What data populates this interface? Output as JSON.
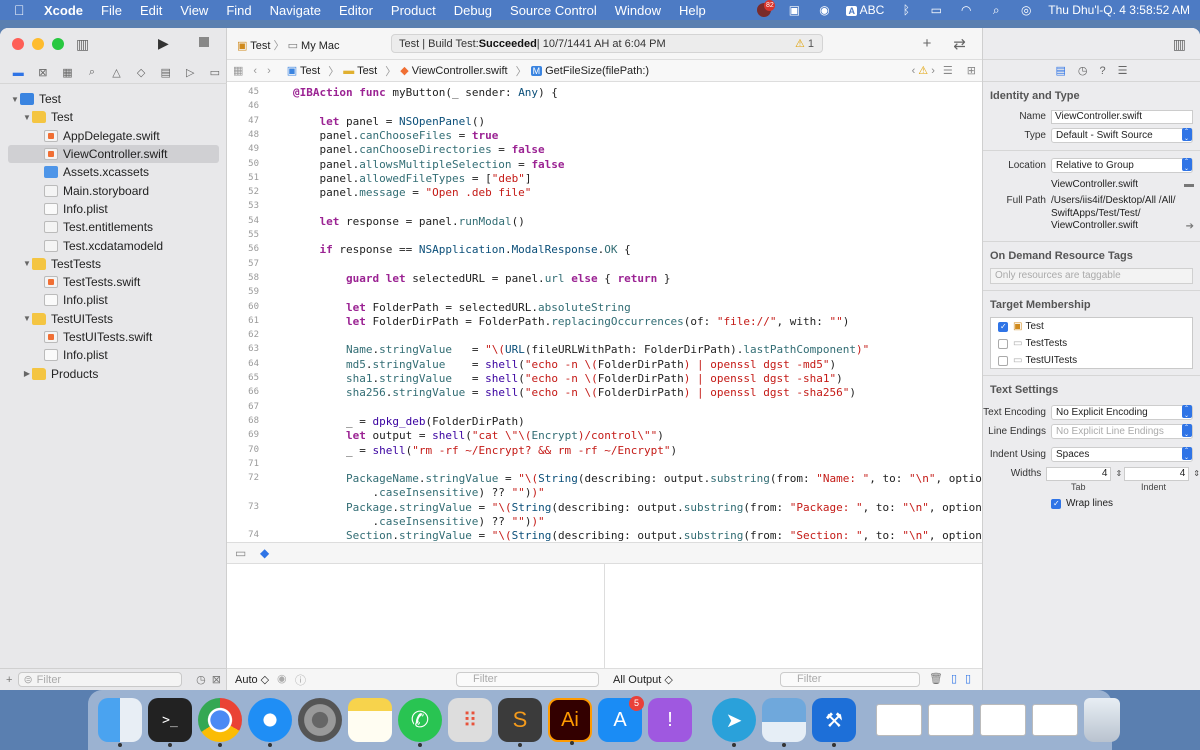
{
  "menubar": {
    "app": "Xcode",
    "items": [
      "File",
      "Edit",
      "View",
      "Find",
      "Navigate",
      "Editor",
      "Product",
      "Debug",
      "Source Control",
      "Window",
      "Help"
    ],
    "status_badge": "82",
    "input_label": "ABC",
    "clock": "Thu Dhu'l-Q. 4  3:58:52 AM"
  },
  "toolbar": {
    "scheme_target": "Test",
    "scheme_device": "My Mac",
    "status_prefix": "Test | Build Test: ",
    "status_bold": "Succeeded",
    "status_suffix": " | 10/7/1441 AH at 6:04 PM",
    "warning_count": "1"
  },
  "jumpbar": {
    "items": [
      "Test",
      "Test",
      "ViewController.swift",
      "GetFileSize(filePath:)"
    ]
  },
  "navigator": {
    "items": [
      {
        "label": "Test",
        "level": 0,
        "icon": "project",
        "disclosure": "open"
      },
      {
        "label": "Test",
        "level": 1,
        "icon": "folder",
        "disclosure": "open"
      },
      {
        "label": "AppDelegate.swift",
        "level": 2,
        "icon": "swift"
      },
      {
        "label": "ViewController.swift",
        "level": 2,
        "icon": "swift",
        "selected": true
      },
      {
        "label": "Assets.xcassets",
        "level": 2,
        "icon": "asset"
      },
      {
        "label": "Main.storyboard",
        "level": 2,
        "icon": "storyboard"
      },
      {
        "label": "Info.plist",
        "level": 2,
        "icon": "plist"
      },
      {
        "label": "Test.entitlements",
        "level": 2,
        "icon": "entitlements"
      },
      {
        "label": "Test.xcdatamodeld",
        "level": 2,
        "icon": "datamodel"
      },
      {
        "label": "TestTests",
        "level": 1,
        "icon": "folder",
        "disclosure": "open"
      },
      {
        "label": "TestTests.swift",
        "level": 2,
        "icon": "swift"
      },
      {
        "label": "Info.plist",
        "level": 2,
        "icon": "plist"
      },
      {
        "label": "TestUITests",
        "level": 1,
        "icon": "folder",
        "disclosure": "open"
      },
      {
        "label": "TestUITests.swift",
        "level": 2,
        "icon": "swift"
      },
      {
        "label": "Info.plist",
        "level": 2,
        "icon": "plist"
      },
      {
        "label": "Products",
        "level": 1,
        "icon": "folder",
        "disclosure": "closed"
      }
    ],
    "filter_placeholder": "Filter"
  },
  "code": [
    {
      "n": "45",
      "h": "<span class='k'>@IBAction</span> <span class='k'>func</span> myButton(_ sender: <span class='t'>Any</span>) {"
    },
    {
      "n": "46",
      "h": ""
    },
    {
      "n": "47",
      "h": "    <span class='k'>let</span> panel = <span class='t'>NSOpenPanel</span>()"
    },
    {
      "n": "48",
      "h": "    panel.<span class='p'>canChooseFiles</span> = <span class='k'>true</span>"
    },
    {
      "n": "49",
      "h": "    panel.<span class='p'>canChooseDirectories</span> = <span class='k'>false</span>"
    },
    {
      "n": "50",
      "h": "    panel.<span class='p'>allowsMultipleSelection</span> = <span class='k'>false</span>"
    },
    {
      "n": "51",
      "h": "    panel.<span class='p'>allowedFileTypes</span> = [<span class='s'>\"deb\"</span>]"
    },
    {
      "n": "52",
      "h": "    panel.<span class='p'>message</span> = <span class='s'>\"Open .deb file\"</span>"
    },
    {
      "n": "53",
      "h": ""
    },
    {
      "n": "54",
      "h": "    <span class='k'>let</span> response = panel.<span class='p'>runModal</span>()"
    },
    {
      "n": "55",
      "h": ""
    },
    {
      "n": "56",
      "h": "    <span class='k'>if</span> response == <span class='t'>NSApplication</span>.<span class='t'>ModalResponse</span>.<span class='p'>OK</span> {"
    },
    {
      "n": "57",
      "h": ""
    },
    {
      "n": "58",
      "h": "        <span class='k'>guard</span> <span class='k'>let</span> selectedURL = panel.<span class='p'>url</span> <span class='k'>else</span> { <span class='k'>return</span> }"
    },
    {
      "n": "59",
      "h": ""
    },
    {
      "n": "60",
      "h": "        <span class='k'>let</span> FolderPath = selectedURL.<span class='p'>absoluteString</span>"
    },
    {
      "n": "61",
      "h": "        <span class='k'>let</span> FolderDirPath = FolderPath.<span class='p'>replacingOccurrences</span>(of: <span class='s'>\"file://\"</span>, with: <span class='s'>\"\"</span>)"
    },
    {
      "n": "62",
      "h": ""
    },
    {
      "n": "63",
      "h": "        <span class='p'>Name</span>.<span class='p'>stringValue</span>   = <span class='s'>\"\\(</span><span class='t'>URL</span>(fileURLWithPath: FolderDirPath).<span class='p'>lastPathComponent</span><span class='s'>)\"</span>"
    },
    {
      "n": "64",
      "h": "        <span class='p'>md5</span>.<span class='p'>stringValue</span>    = <span class='f'>shell</span>(<span class='s'>\"echo -n \\(</span>FolderDirPath<span class='s'>) | openssl dgst -md5\"</span>)"
    },
    {
      "n": "65",
      "h": "        <span class='p'>sha1</span>.<span class='p'>stringValue</span>   = <span class='f'>shell</span>(<span class='s'>\"echo -n \\(</span>FolderDirPath<span class='s'>) | openssl dgst -sha1\"</span>)"
    },
    {
      "n": "66",
      "h": "        <span class='p'>sha256</span>.<span class='p'>stringValue</span> = <span class='f'>shell</span>(<span class='s'>\"echo -n \\(</span>FolderDirPath<span class='s'>) | openssl dgst -sha256\"</span>)"
    },
    {
      "n": "67",
      "h": ""
    },
    {
      "n": "68",
      "h": "        _ = <span class='f'>dpkg_deb</span>(FolderDirPath)"
    },
    {
      "n": "69",
      "h": "        <span class='k'>let</span> output = <span class='f'>shell</span>(<span class='s'>\"cat \\\"\\(</span><span class='p'>Encrypt</span><span class='s'>)/control\\\"\"</span>)"
    },
    {
      "n": "70",
      "h": "        _ = <span class='f'>shell</span>(<span class='s'>\"rm -rf ~/Encrypt? &amp;&amp; rm -rf ~/Encrypt\"</span>)"
    },
    {
      "n": "71",
      "h": ""
    },
    {
      "n": "72",
      "h": "        <span class='p'>PackageName</span>.<span class='p'>stringValue</span> = <span class='s'>\"\\(</span><span class='t'>String</span>(describing: output.<span class='p'>substring</span>(from: <span class='s'>\"Name: \"</span>, to: <span class='s'>\"\\n\"</span>, options:"
    },
    {
      "n": "",
      "h": "            .<span class='p'>caseInsensitive</span>) ?? <span class='s'>\"\"</span>)<span class='s'>)\"</span>"
    },
    {
      "n": "73",
      "h": "        <span class='p'>Package</span>.<span class='p'>stringValue</span> = <span class='s'>\"\\(</span><span class='t'>String</span>(describing: output.<span class='p'>substring</span>(from: <span class='s'>\"Package: \"</span>, to: <span class='s'>\"\\n\"</span>, options:"
    },
    {
      "n": "",
      "h": "            .<span class='p'>caseInsensitive</span>) ?? <span class='s'>\"\"</span>)<span class='s'>)\"</span>"
    },
    {
      "n": "74",
      "h": "        <span class='p'>Section</span>.<span class='p'>stringValue</span> = <span class='s'>\"\\(</span><span class='t'>String</span>(describing: output.<span class='p'>substring</span>(from: <span class='s'>\"Section: \"</span>, to: <span class='s'>\"\\n\"</span>, options:"
    }
  ],
  "debug": {
    "auto_label": "Auto ◇",
    "filter_placeholder": "Filter",
    "output_label": "All Output ◇"
  },
  "inspector": {
    "identity_title": "Identity and Type",
    "name_label": "Name",
    "name_value": "ViewController.swift",
    "type_label": "Type",
    "type_value": "Default - Swift Source",
    "location_label": "Location",
    "location_value": "Relative to Group",
    "location_file": "ViewController.swift",
    "fullpath_label": "Full Path",
    "fullpath_value": "/Users/iis4if/Desktop/All /All/ SwiftApps/Test/Test/ ViewController.swift",
    "odr_title": "On Demand Resource Tags",
    "odr_placeholder": "Only resources are taggable",
    "target_title": "Target Membership",
    "targets": [
      {
        "label": "Test",
        "checked": true
      },
      {
        "label": "TestTests",
        "checked": false
      },
      {
        "label": "TestUITests",
        "checked": false
      }
    ],
    "text_title": "Text Settings",
    "encoding_label": "Text Encoding",
    "encoding_value": "No Explicit Encoding",
    "endings_label": "Line Endings",
    "endings_value": "No Explicit Line Endings",
    "indent_label": "Indent Using",
    "indent_value": "Spaces",
    "widths_label": "Widths",
    "tab_value": "4",
    "indent_width_value": "4",
    "tab_label": "Tab",
    "indent_sub_label": "Indent",
    "wrap_label": "Wrap lines"
  },
  "dock": {
    "appstore_badge": "5",
    "ai_label": "Ai"
  },
  "colors": {
    "accent": "#2f74e6",
    "menubar": "#4d7bc4",
    "keyword": "#9b2393",
    "string": "#c41a16"
  }
}
